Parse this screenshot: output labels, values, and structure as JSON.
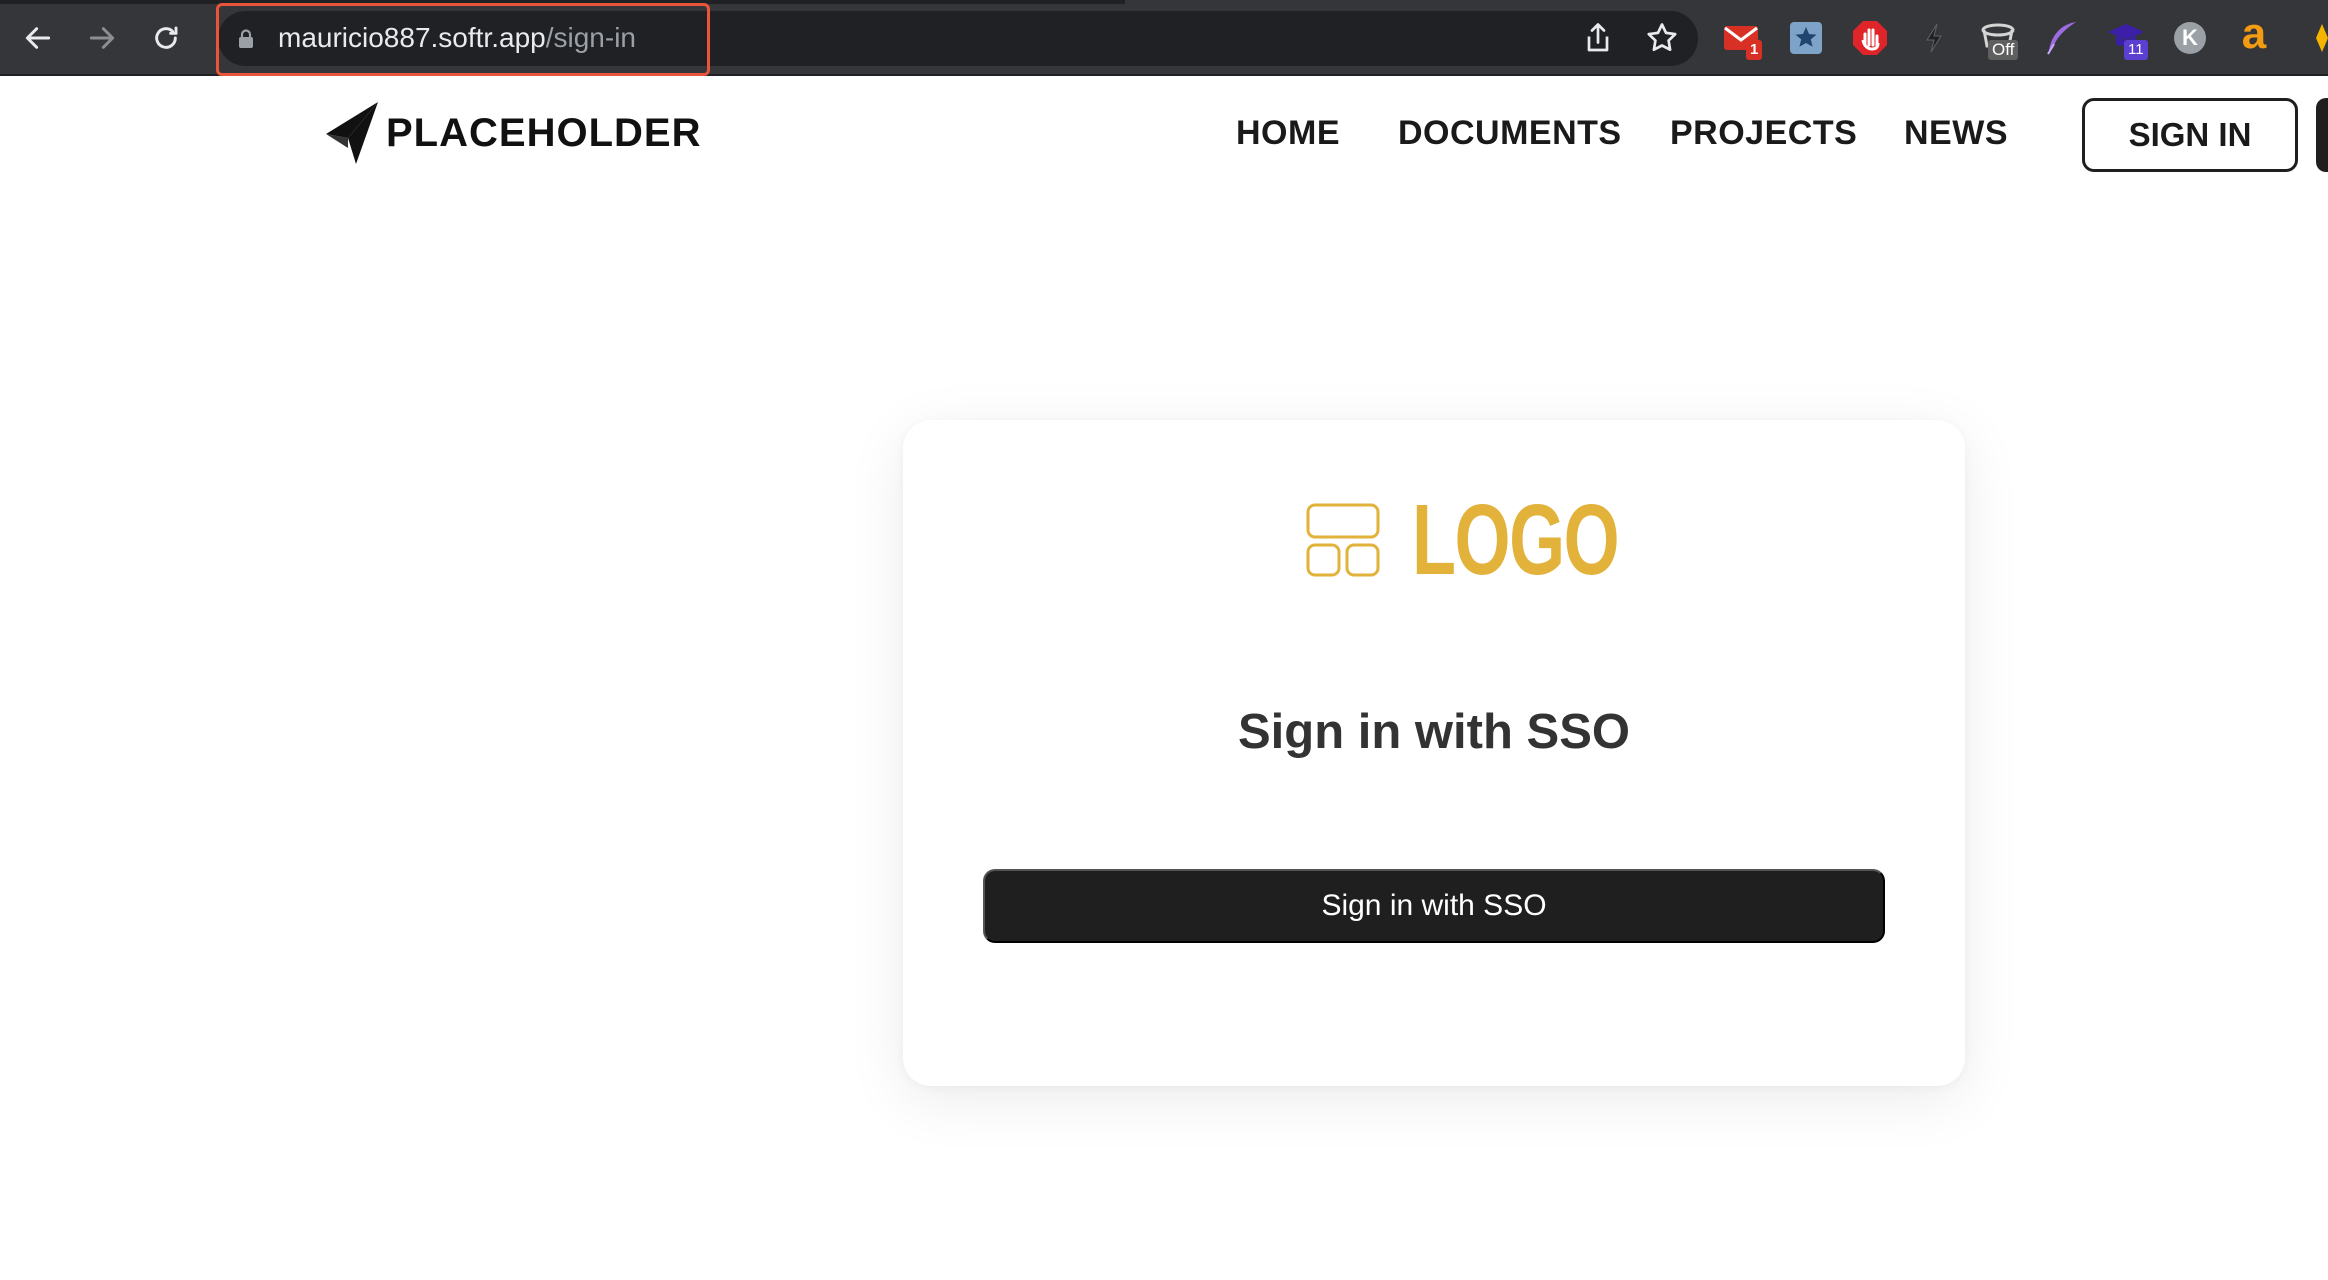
{
  "browser": {
    "url_host": "mauricio887.softr.app",
    "url_path": "/sign-in",
    "extensions": [
      {
        "name": "gmail-icon",
        "badge": "1"
      },
      {
        "name": "bookmark-star-extension-icon"
      },
      {
        "name": "adblock-hand-icon"
      },
      {
        "name": "lightning-extension-icon"
      },
      {
        "name": "cup-extension-icon",
        "badge": "Off"
      },
      {
        "name": "quill-extension-icon"
      },
      {
        "name": "graduation-cap-extension-icon",
        "badge": "11"
      },
      {
        "name": "profile-k-icon",
        "letter": "K"
      },
      {
        "name": "amazon-assistant-icon",
        "letter": "a"
      }
    ]
  },
  "header": {
    "brand_name": "PLACEHOLDER",
    "nav": {
      "home": "HOME",
      "documents": "DOCUMENTS",
      "projects": "PROJECTS",
      "news": "NEWS"
    },
    "sign_in_label": "SIGN IN"
  },
  "card": {
    "logo_text": "LOGO",
    "title": "Sign in with SSO",
    "button_label": "Sign in with SSO"
  },
  "colors": {
    "accent_logo": "#e2b23b",
    "button_dark": "#1f1f1f",
    "url_highlight": "#e8553a"
  }
}
